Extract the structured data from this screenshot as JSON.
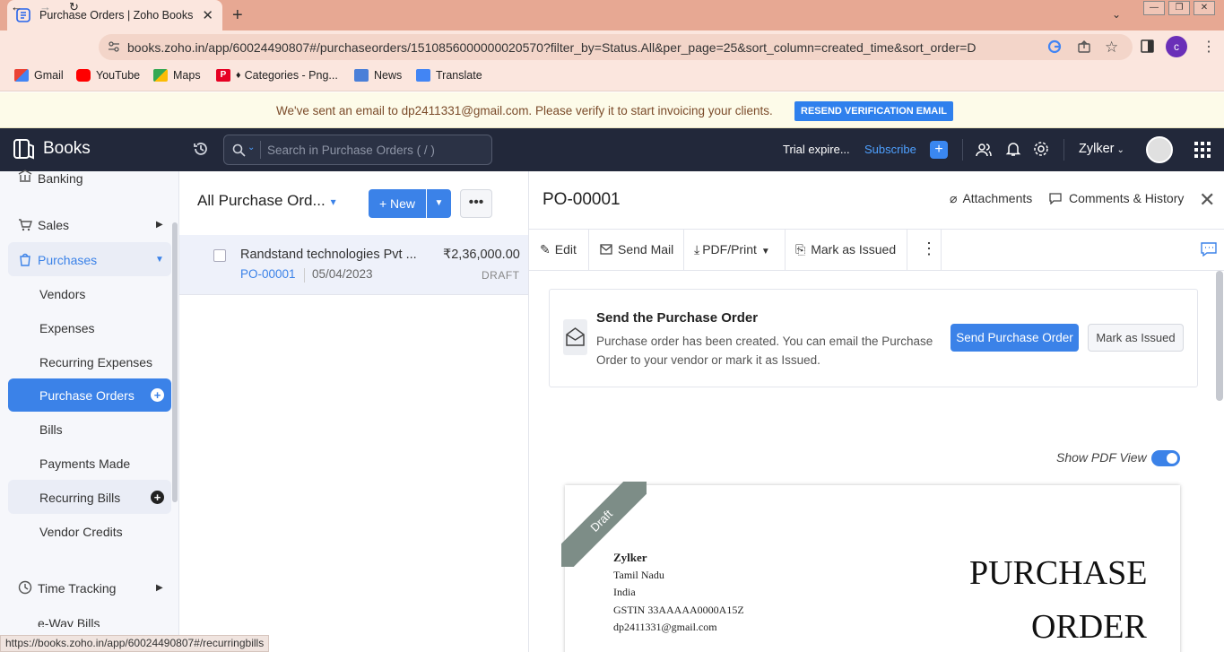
{
  "browser": {
    "tab_title": "Purchase Orders | Zoho Books",
    "url": "books.zoho.in/app/60024490807#/purchaseorders/1510856000000020570?filter_by=Status.All&per_page=25&sort_column=created_time&sort_order=D",
    "profile_initial": "c",
    "bookmarks": [
      "Gmail",
      "YouTube",
      "Maps",
      "Categories - Png...",
      "News",
      "Translate"
    ],
    "status_url": "https://books.zoho.in/app/60024490807#/recurringbills"
  },
  "banner": {
    "text": "We've sent an email to dp2411331@gmail.com. Please verify it to start invoicing your clients.",
    "button": "RESEND VERIFICATION EMAIL"
  },
  "header": {
    "app_name": "Books",
    "search_placeholder": "Search in Purchase Orders ( / )",
    "trial": "Trial expire...",
    "subscribe": "Subscribe",
    "org": "Zylker"
  },
  "sidebar": {
    "banking": "Banking",
    "sales": "Sales",
    "purchases": "Purchases",
    "items": [
      "Vendors",
      "Expenses",
      "Recurring Expenses",
      "Purchase Orders",
      "Bills",
      "Payments Made",
      "Recurring Bills",
      "Vendor Credits"
    ],
    "time_tracking": "Time Tracking",
    "eway": "e-Way Bills"
  },
  "list": {
    "title": "All Purchase Ord...",
    "new_label": "New",
    "rows": [
      {
        "vendor": "Randstand technologies Pvt ...",
        "amount": "₹2,36,000.00",
        "number": "PO-00001",
        "date": "05/04/2023",
        "status": "DRAFT"
      }
    ]
  },
  "detail": {
    "title": "PO-00001",
    "attachments": "Attachments",
    "comments": "Comments & History",
    "actions": {
      "edit": "Edit",
      "send_mail": "Send Mail",
      "pdf_print": "PDF/Print",
      "mark_issued": "Mark as Issued"
    },
    "card": {
      "title": "Send the Purchase Order",
      "desc": "Purchase order has been created. You can email the Purchase Order to your vendor or mark it as Issued.",
      "send_btn": "Send Purchase Order",
      "mark_btn": "Mark as Issued"
    },
    "pdf_view_label": "Show PDF View",
    "pdf_view_on": true,
    "pdf": {
      "ribbon": "Draft",
      "company": "Zylker",
      "state": "Tamil Nadu",
      "country": "India",
      "gstin": "GSTIN 33AAAAA0000A15Z",
      "email": "dp2411331@gmail.com",
      "title_line1": "PURCHASE",
      "title_line2": "ORDER"
    }
  },
  "colors": {
    "accent": "#3b82e8",
    "header_bg": "#22283a",
    "tabstrip": "#e7a893"
  }
}
